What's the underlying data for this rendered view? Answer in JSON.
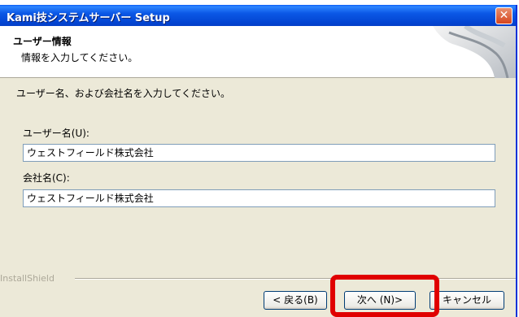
{
  "window": {
    "title": "Kami技システムサーバー Setup",
    "close_glyph": "✕"
  },
  "header": {
    "title": "ユーザー情報",
    "subtitle": "情報を入力してください。"
  },
  "body": {
    "instruction": "ユーザー名、および会社名を入力してください。"
  },
  "fields": {
    "user_label": "ユーザー名(U):",
    "user_value": "ウェストフィールド株式会社",
    "company_label": "会社名(C):",
    "company_value": "ウェストフィールド株式会社"
  },
  "footer": {
    "brand": "InstallShield"
  },
  "buttons": {
    "back": "< 戻る(B)",
    "next": "次へ (N)>",
    "cancel": "キャンセル"
  },
  "colors": {
    "titlebar": "#0a5cf5",
    "highlight": "#e00000",
    "dialog_bg": "#ece9d8"
  }
}
